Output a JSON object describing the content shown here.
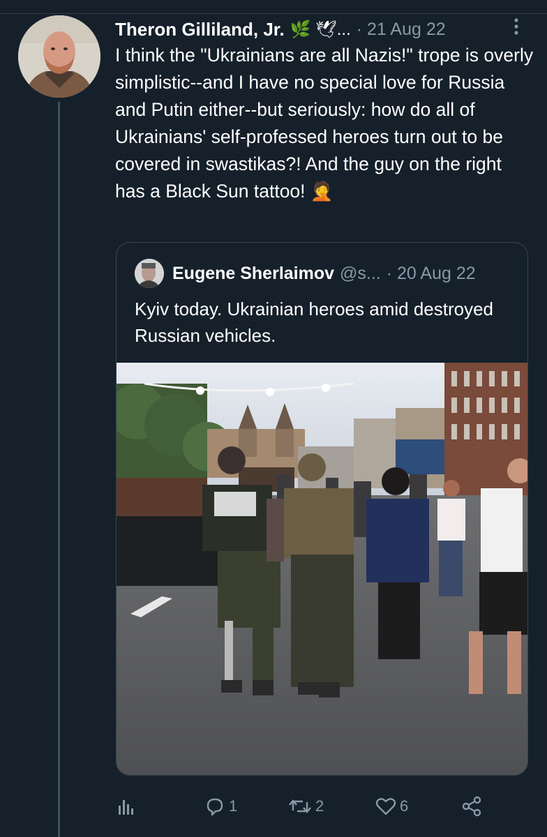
{
  "tweet": {
    "author_name": "Theron Gilliland, Jr.",
    "author_badges": "🌿 🕊...",
    "date": "· 21 Aug 22",
    "text": "I think the \"Ukrainians are all Nazis!\" trope is overly simplistic--and I have no special love for Russia and Putin either--but seriously: how do all of Ukrainians' self-professed heroes turn out to be covered in swastikas?! And the guy on the right has a Black Sun tattoo! 🤦"
  },
  "quote": {
    "author_name": "Eugene Sherlaimov",
    "handle": "@s...",
    "date": "· 20 Aug 22",
    "text": "Kyiv today. Ukrainian heroes amid destroyed Russian vehicles."
  },
  "actions": {
    "replies": "1",
    "retweets": "2",
    "likes": "6"
  },
  "icons": {
    "more": "more-vertical-icon",
    "analytics": "analytics-icon",
    "reply": "reply-icon",
    "retweet": "retweet-icon",
    "like": "heart-icon",
    "share": "share-icon"
  },
  "colors": {
    "background": "#15202b",
    "text": "#ffffff",
    "secondary_text": "#8899a6",
    "border": "#38444d"
  }
}
